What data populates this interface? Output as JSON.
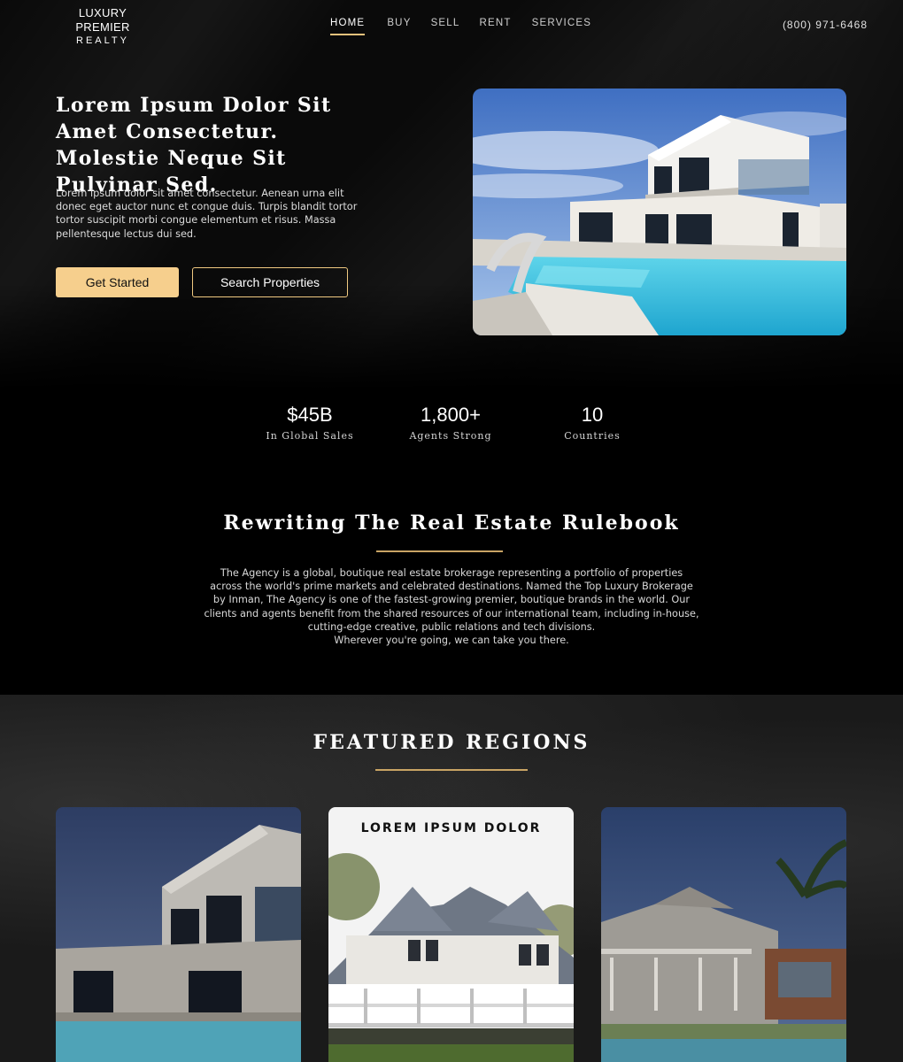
{
  "header": {
    "logo_line1": "LUXURY PREMIER",
    "logo_line2": "REALTY",
    "nav": [
      {
        "label": "HOME",
        "active": true
      },
      {
        "label": "BUY",
        "active": false
      },
      {
        "label": "SELL",
        "active": false
      },
      {
        "label": "RENT",
        "active": false
      },
      {
        "label": "SERVICES",
        "active": false
      }
    ],
    "phone": "(800) 971-6468"
  },
  "hero": {
    "title": "Lorem Ipsum Dolor Sit Amet Consectetur. Molestie Neque Sit Pulvinar Sed.",
    "description": "Lorem ipsum dolor sit amet consectetur. Aenean urna elit donec eget auctor nunc et congue duis. Turpis blandit tortor tortor suscipit morbi congue elementum et risus. Massa pellentesque lectus dui sed.",
    "primary_button": "Get Started",
    "secondary_button": "Search Properties"
  },
  "stats": [
    {
      "value": "$45B",
      "label": "In Global Sales"
    },
    {
      "value": "1,800+",
      "label": "Agents Strong"
    },
    {
      "value": "10",
      "label": "Countries"
    }
  ],
  "about": {
    "title": "Rewriting The Real Estate Rulebook",
    "body": "The Agency is a global, boutique real estate brokerage representing a portfolio of properties across the world's prime markets and celebrated destinations. Named the Top Luxury Brokerage by Inman, The Agency is one of the fastest-growing premier, boutique brands in the world. Our clients and agents benefit from the shared resources of our international team, including in-house, cutting-edge creative, public relations and tech divisions.",
    "tagline": "Wherever you're going, we can take you there."
  },
  "featured": {
    "title": "FEATURED REGIONS",
    "cards": [
      {
        "label": ""
      },
      {
        "label": "LOREM IPSUM DOLOR"
      },
      {
        "label": ""
      }
    ]
  },
  "colors": {
    "accent": "#f6cf8d",
    "accent_line": "#c9a464",
    "background": "#000000"
  }
}
